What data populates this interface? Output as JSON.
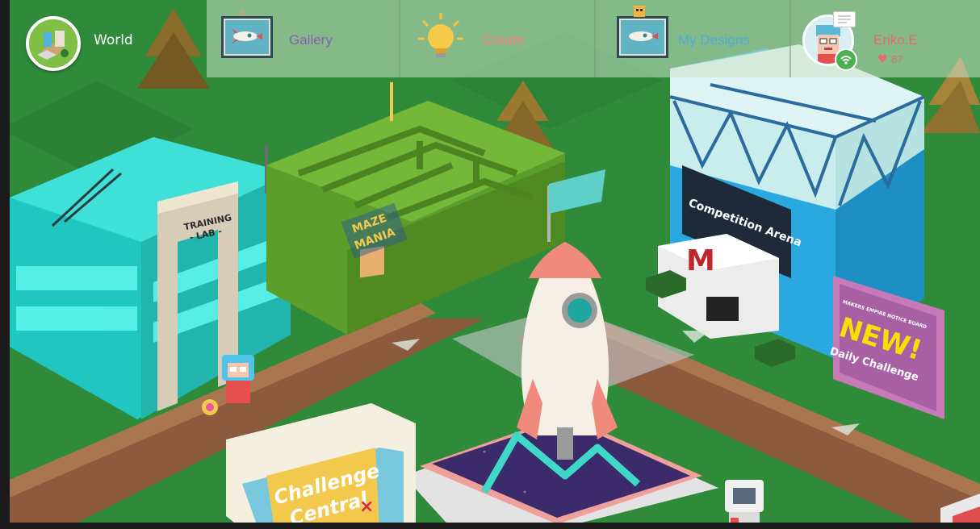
{
  "topbar": {
    "world_label": "World",
    "nav": [
      {
        "label": "Gallery",
        "color": "#8a5fb0"
      },
      {
        "label": "Create",
        "color": "#ff7f7f"
      },
      {
        "label": "My Designs",
        "color": "#4aaedb"
      }
    ],
    "user": {
      "name": "Eriko.E",
      "hearts": "87"
    }
  },
  "scene": {
    "training_lab_sign": [
      "TRAINING",
      "- LAB -"
    ],
    "maze_sign": [
      "MAZE",
      "MANIA"
    ],
    "competition_sign": "Competition Arena",
    "notice_board": {
      "header": "MAKERS EMPIRE NOTICE BOARD",
      "headline": "NEW!",
      "subline": "Daily Challenge"
    },
    "challenge_sign": [
      "Challenge",
      "Central"
    ]
  },
  "colors": {
    "grass": "#2f8a3a",
    "path": "#8c5a3c",
    "accent": "#4aaedb"
  }
}
